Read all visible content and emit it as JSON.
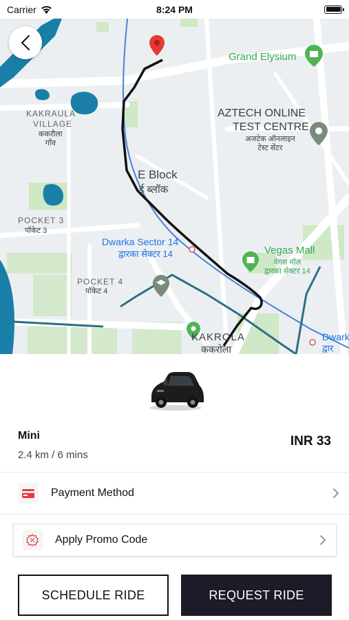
{
  "status_bar": {
    "carrier": "Carrier",
    "time": "8:24 PM"
  },
  "map": {
    "labels": {
      "grand_elysium": "Grand Elysium",
      "aztech_line1": "AZTECH ONLINE",
      "aztech_line2": "TEST CENTRE",
      "aztech_hindi": "अजटेक ऑनलाइन\nटेस्ट सेंटर",
      "kakraula_line1": "KAKRAULA",
      "kakraula_line2": "VILLAGE",
      "kakraula_hindi": "ककरौला\nगाँव",
      "eblock": "E Block",
      "eblock_hindi": "ई ब्लॉक",
      "pocket3": "POCKET 3",
      "pocket3_hindi": "पॉकेट 3",
      "dwarka14": "Dwarka Sector 14",
      "dwarka14_hindi": "द्वारका सेक्टर 14",
      "vegas_mall": "Vegas Mall",
      "vegas_hindi": "वेगस मॉल\nद्वारका सेक्टर 14",
      "pocket4": "POCKET 4",
      "pocket4_hindi": "पॉकेट 4",
      "kakrola": "KAKROLA",
      "kakrola_hindi": "ककरोला",
      "dwark_edge": "Dwark",
      "dwark_edge_hindi": "द्वार"
    },
    "colors": {
      "route": "#111111",
      "water": "#1a7fa8",
      "park": "#c8e6c0",
      "rail": "#4a80d8"
    }
  },
  "ride": {
    "name": "Mini",
    "meta": "2.4 km / 6 mins",
    "price": "INR 33"
  },
  "payment": {
    "label": "Payment Method",
    "icon": "card-icon"
  },
  "promo": {
    "label": "Apply Promo Code",
    "icon": "discount-icon"
  },
  "buttons": {
    "schedule": "SCHEDULE RIDE",
    "request": "REQUEST RIDE"
  }
}
